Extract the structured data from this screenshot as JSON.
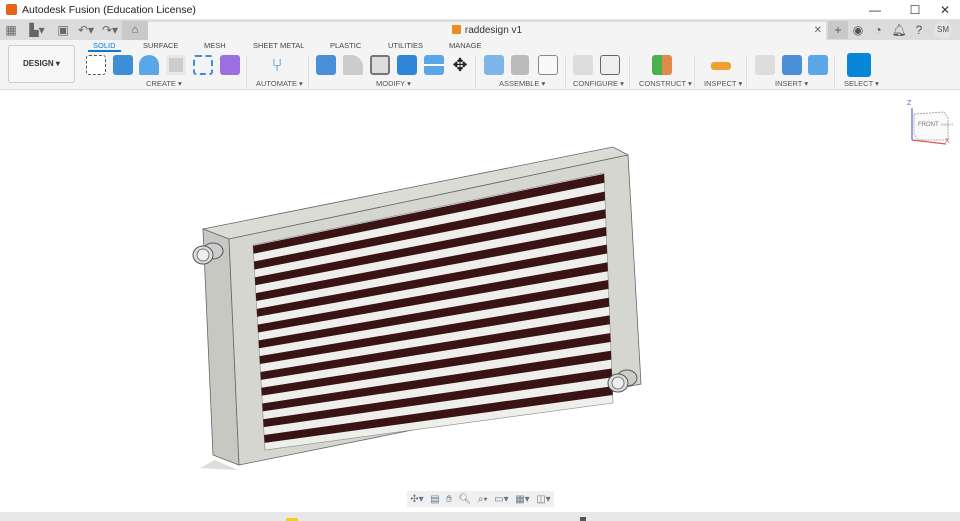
{
  "window": {
    "title": "Autodesk Fusion (Education License)",
    "minimize": "—",
    "maximize": "☐",
    "close": "✕"
  },
  "document_tab": {
    "name": "raddesign v1",
    "close": "✕"
  },
  "user": {
    "initials": "SM"
  },
  "workspace": {
    "label": "DESIGN ▾"
  },
  "tabs": [
    "SOLID",
    "SURFACE",
    "MESH",
    "SHEET METAL",
    "PLASTIC",
    "UTILITIES",
    "MANAGE"
  ],
  "groups": [
    "CREATE ▾",
    "AUTOMATE ▾",
    "MODIFY ▾",
    "ASSEMBLE ▾",
    "CONFIGURE ▾",
    "CONSTRUCT ▾",
    "INSPECT ▾",
    "INSERT ▾",
    "SELECT ▾"
  ],
  "viewcube": {
    "face": "FRONT",
    "right": "RIGHT",
    "axis_z": "Z",
    "axis_x": "X"
  },
  "colors": {
    "accent": "#0a7ad4",
    "body": "#d8d8d2",
    "fins": "#3a1414"
  }
}
